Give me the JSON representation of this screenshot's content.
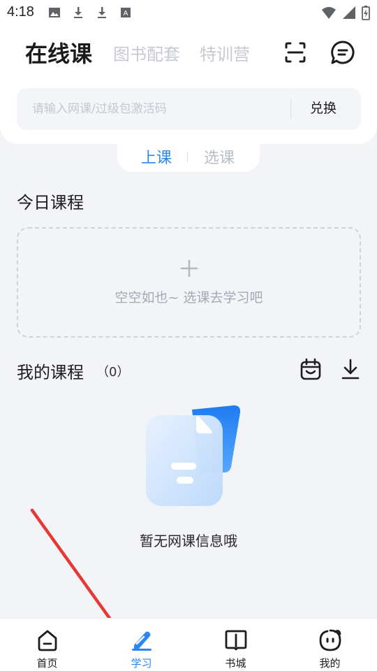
{
  "status_bar": {
    "time": "4:18",
    "left_icons": [
      "image-icon",
      "download-icon",
      "download-icon",
      "font-icon"
    ],
    "right_icons": [
      "wifi-icon",
      "signal-icon",
      "battery-charging-icon"
    ]
  },
  "header": {
    "tabs": [
      {
        "label": "在线课",
        "active": true
      },
      {
        "label": "图书配套",
        "active": false
      },
      {
        "label": "特训营",
        "active": false
      }
    ],
    "actions": [
      "scan-icon",
      "message-icon"
    ]
  },
  "redeem": {
    "placeholder": "请输入网课/过级包激活码",
    "button_label": "兑换"
  },
  "subtabs": [
    {
      "label": "上课",
      "active": true
    },
    {
      "label": "选课",
      "active": false
    }
  ],
  "today": {
    "title": "今日课程",
    "empty_text": "空空如也~ 选课去学习吧"
  },
  "my_courses": {
    "title": "我的课程",
    "count": "（0）",
    "empty_text": "暂无网课信息哦"
  },
  "bottom_nav": [
    {
      "label": "首页",
      "icon": "home-icon",
      "active": false
    },
    {
      "label": "学习",
      "icon": "study-icon",
      "active": true
    },
    {
      "label": "书城",
      "icon": "book-icon",
      "active": false
    },
    {
      "label": "我的",
      "icon": "profile-icon",
      "active": false
    }
  ],
  "colors": {
    "accent": "#2a86f0",
    "annotation_arrow": "#e53935",
    "background": "#f3f4f8"
  }
}
